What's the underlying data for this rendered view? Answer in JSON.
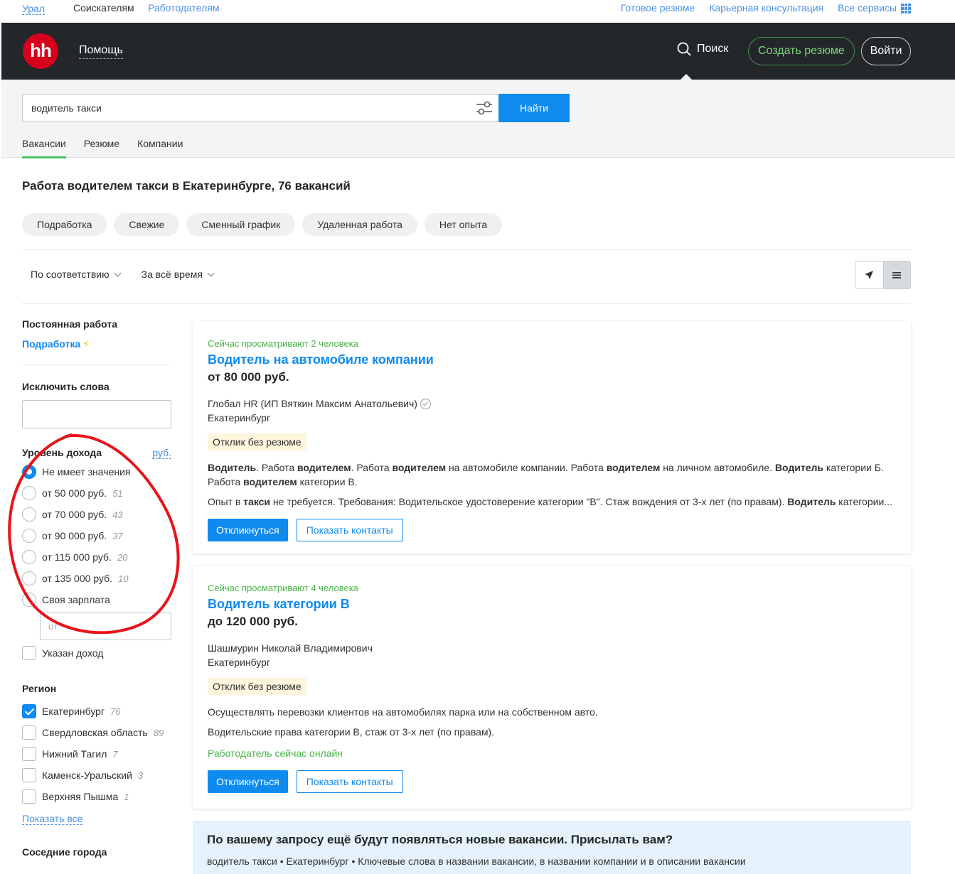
{
  "topbar": {
    "region": "Урал",
    "seekers": "Соискателям",
    "employers": "Работодателям",
    "links": [
      "Готовое резюме",
      "Карьерная консультация",
      "Все сервисы"
    ]
  },
  "header": {
    "logo": "hh",
    "help": "Помощь",
    "search": "Поиск",
    "create_resume": "Создать резюме",
    "login": "Войти"
  },
  "search": {
    "query": "водитель такси",
    "find_button": "Найти",
    "tabs": [
      "Вакансии",
      "Резюме",
      "Компании"
    ]
  },
  "page": {
    "title": "Работа водителем такси в Екатеринбурге, 76 вакансий",
    "chips": [
      "Подработка",
      "Свежие",
      "Сменный график",
      "Удаленная работа",
      "Нет опыта"
    ],
    "sort": "По соответствию",
    "period": "За всё время"
  },
  "sidebar": {
    "permanent": "Постоянная работа",
    "part_time": "Подработка",
    "exclude_title": "Исключить слова",
    "income_title": "Уровень дохода",
    "currency": "руб.",
    "income_options": [
      {
        "label": "Не имеет значения",
        "count": "",
        "selected": true
      },
      {
        "label": "от 50 000 руб.",
        "count": "51",
        "selected": false
      },
      {
        "label": "от 70 000 руб.",
        "count": "43",
        "selected": false
      },
      {
        "label": "от 90 000 руб.",
        "count": "37",
        "selected": false
      },
      {
        "label": "от 115 000 руб.",
        "count": "20",
        "selected": false
      },
      {
        "label": "от 135 000 руб.",
        "count": "10",
        "selected": false
      },
      {
        "label": "Своя зарплата",
        "count": "",
        "selected": false
      }
    ],
    "own_salary_placeholder": "от",
    "income_specified": "Указан доход",
    "region_title": "Регион",
    "regions": [
      {
        "label": "Екатеринбург",
        "count": "76",
        "checked": true
      },
      {
        "label": "Свердловская область",
        "count": "89",
        "checked": false
      },
      {
        "label": "Нижний Тагил",
        "count": "7",
        "checked": false
      },
      {
        "label": "Каменск-Уральский",
        "count": "3",
        "checked": false
      },
      {
        "label": "Верхняя Пышма",
        "count": "1",
        "checked": false
      }
    ],
    "show_all": "Показать все",
    "neighbor_cities": "Соседние города"
  },
  "vacancies": [
    {
      "watching": "Сейчас просматривают 2 человека",
      "title": "Водитель на автомобиле компании",
      "salary": "от 80 000 руб.",
      "company": "Глобал HR (ИП Вяткин Максим Анатольевич)",
      "city": "Екатеринбург",
      "badge": "Отклик без резюме",
      "respond": "Откликнуться",
      "contacts": "Показать контакты"
    },
    {
      "watching": "Сейчас просматривают 4 человека",
      "title": "Водитель категории B",
      "salary": "до 120 000 руб.",
      "company": "Шашмурин Николай Владимирович",
      "city": "Екатеринбург",
      "badge": "Отклик без резюме",
      "desc1": "Осуществлять перевозки клиентов на автомобилях парка или на собственном авто.",
      "desc2": "Водительские права категории B, стаж от 3-х лет (по правам).",
      "online": "Работодатель сейчас онлайн",
      "respond": "Откликнуться",
      "contacts": "Показать контакты"
    }
  ],
  "subscribe": {
    "question": "По вашему запросу ещё будут появляться новые вакансии. Присылать вам?",
    "meta": "водитель такси • Екатеринбург • Ключевые слова в названии вакансии, в названии компании и в описании вакансии"
  },
  "colors": {
    "accent": "#0f8aee",
    "brand": "#d6001c",
    "green": "#4bb34b",
    "annotation": "#e8131b"
  }
}
